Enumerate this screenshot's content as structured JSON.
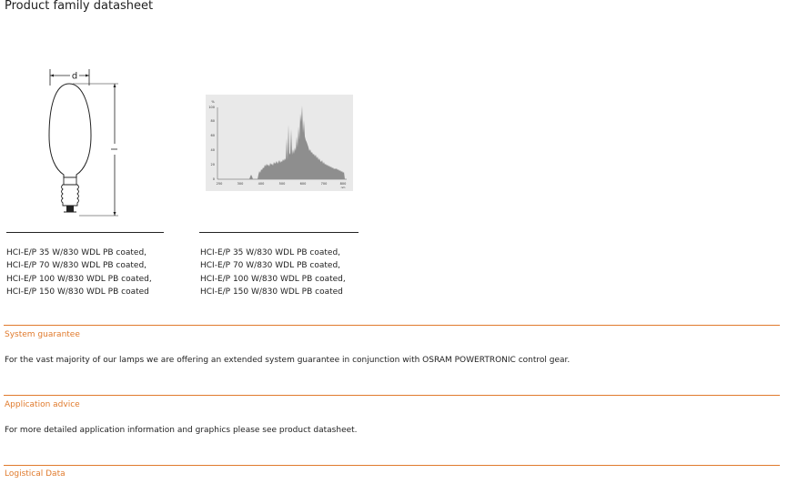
{
  "header": {
    "title": "Product family datasheet"
  },
  "lamp_drawing": {
    "dimension_d": "d",
    "dimension_l": "l"
  },
  "spectrum": {
    "y_unit": "%",
    "y_ticks": [
      "100",
      "80",
      "60",
      "40",
      "20",
      "0"
    ],
    "x_ticks": [
      "300",
      "400",
      "500",
      "600",
      "700",
      "800"
    ],
    "x_start": "250",
    "x_unit": "nm"
  },
  "captions": {
    "left": [
      "HCI-E/P 35 W/830 WDL PB coated,",
      "HCI-E/P 70 W/830 WDL PB coated,",
      "HCI-E/P 100 W/830 WDL PB coated,",
      "HCI-E/P 150 W/830 WDL PB coated"
    ],
    "right": [
      "HCI-E/P 35 W/830 WDL PB coated,",
      "HCI-E/P 70 W/830 WDL PB coated,",
      "HCI-E/P 100 W/830 WDL PB coated,",
      "HCI-E/P 150 W/830 WDL PB coated"
    ]
  },
  "sections": [
    {
      "heading": "System guarantee",
      "text": "For the vast majority of our lamps we are offering an extended system guarantee in conjunction with OSRAM POWERTRONIC control gear."
    },
    {
      "heading": "Application advice",
      "text": "For more detailed application information and graphics please see product datasheet."
    },
    {
      "heading": "Logistical Data",
      "text": ""
    }
  ],
  "colors": {
    "accent": "#e07a2c",
    "text": "#222222"
  }
}
